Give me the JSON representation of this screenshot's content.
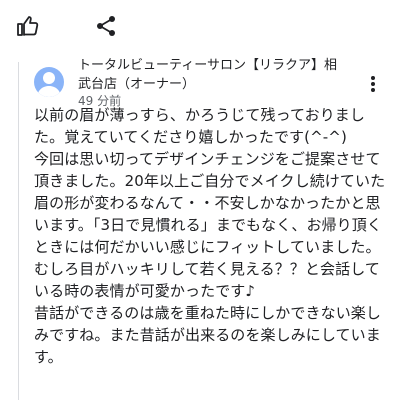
{
  "actions": {
    "like_icon": "thumbs-up-icon",
    "share_icon": "share-icon",
    "more_icon": "more-vert-icon"
  },
  "owner_reply": {
    "author_line1": "トータルビューティーサロン【リラクア】相",
    "author_line2": "武台店（オーナー）",
    "timestamp": "49 分前",
    "text": "以前の眉が薄っすら、かろうじて残っておりました。覚えていてくださり嬉しかったです(^-^)\n今回は思い切ってデザインチェンジをご提案させて頂きました。20年以上ご自分でメイクし続けていた眉の形が変わるなんて・・不安しかなかったかと思います。「3日で見慣れる」までもなく、お帰り頂くときには何だかいい感じにフィットしていました。むしろ目がハッキリして若く見える？？と会話している時の表情が可愛かったです♪\n昔話ができるのは歳を重ねた時にしかできない楽しみですね。また昔話が出来るのを楽しみにしています。"
  },
  "colors": {
    "text": "#202124",
    "secondary": "#5f6368",
    "avatar_bg": "#8ab4f8",
    "divider": "#dadce0"
  }
}
